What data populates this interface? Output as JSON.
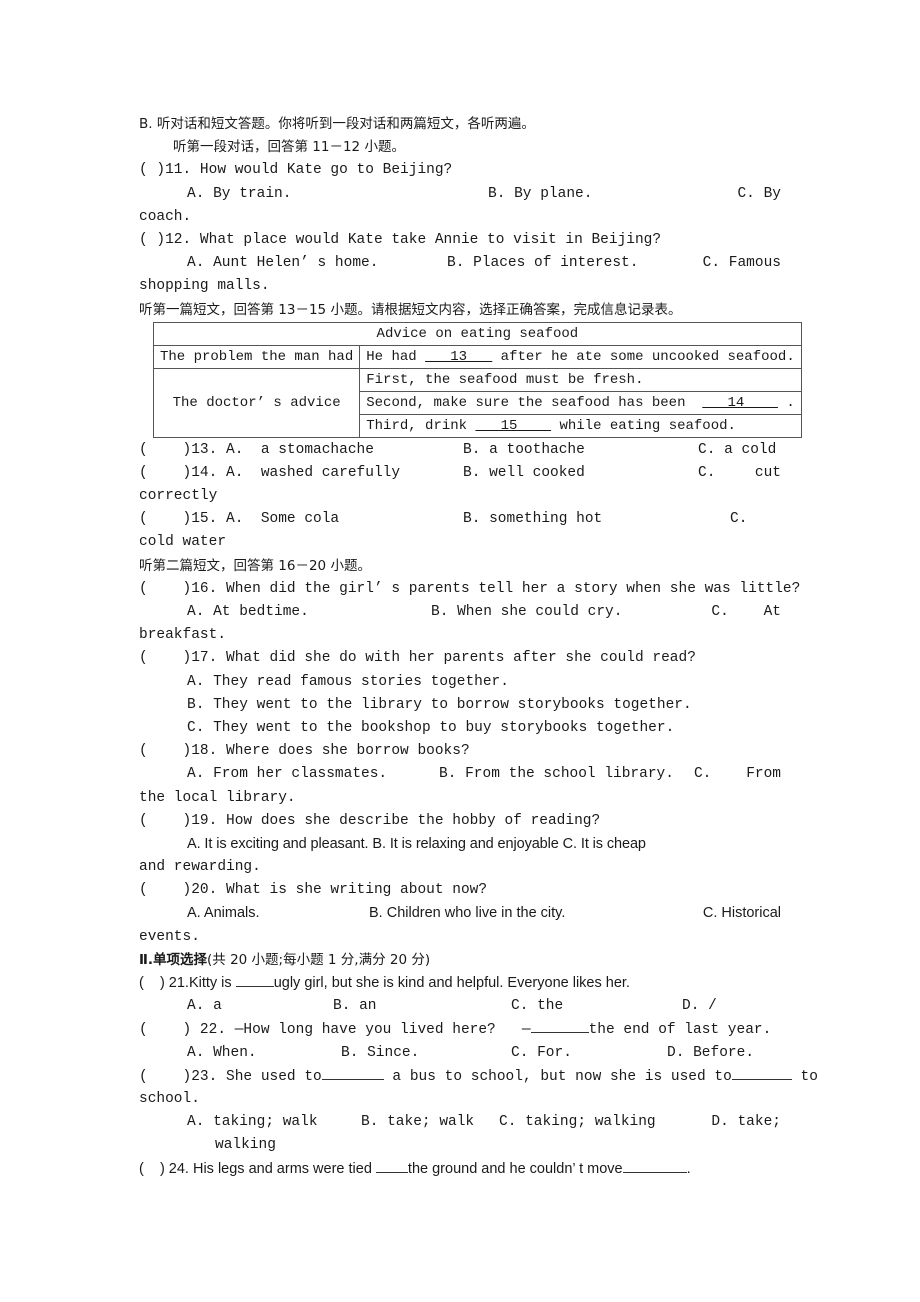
{
  "section_b": {
    "heading": "B.  听对话和短文答题。你将听到一段对话和两篇短文，各听两遍。",
    "dialogue_intro": "听第一段对话，回答第 11－12 小题。"
  },
  "q11": {
    "stem": "(    )11. How would Kate go to Beijing?",
    "a": "A. By train.",
    "b": "B. By plane.",
    "c": "C. By",
    "c_cont": "coach."
  },
  "q12": {
    "stem": "(    )12. What place would Kate take Annie to visit in Beijing?",
    "a": "A. Aunt Helen’ s home.",
    "b": "B.  Places  of  interest.",
    "c": "C.  Famous",
    "c_cont": "shopping malls."
  },
  "passage1_intro": "听第一篇短文，回答第 13－15 小题。请根据短文内容，选择正确答案，完成信息记录表。",
  "info_table": {
    "title": "Advice on eating seafood",
    "row1_label": "The problem the man had",
    "row1_pre": "He had ",
    "row1_blank": "   13   ",
    "row1_post": " after he ate some uncooked seafood.",
    "row2_label": "The doctor’ s advice",
    "advice1": "First, the seafood must be fresh.",
    "advice2_pre": "Second, make sure the seafood has been  ",
    "advice2_blank": "   14    ",
    "advice2_post": " .",
    "advice3_pre": "Third, drink ",
    "advice3_blank": "   15    ",
    "advice3_post": " while eating seafood."
  },
  "q13": {
    "stem": "(    )13. A.  a stomachache",
    "b": "B.  a toothache",
    "c": "C.  a cold"
  },
  "q14": {
    "stem": "(    )14. A.  washed carefully",
    "b": "B.  well cooked",
    "c": "C.",
    "c_word": "cut",
    "c_cont": "correctly"
  },
  "q15": {
    "stem": "(    )15. A.  Some cola",
    "b": "B.  something hot",
    "c": "C.",
    "c_cont": "cold water"
  },
  "passage2_intro": "听第二篇短文，回答第 16－20 小题。",
  "q16": {
    "stem": "(    )16. When did the girl’ s parents tell her a story when she was little?",
    "a": "A. At bedtime.",
    "b": "B. When she could cry.",
    "c": "C.    At",
    "c_cont": "breakfast."
  },
  "q17": {
    "stem": "(    )17. What did she do with her parents after she could read?",
    "a": "A. They read famous stories together.",
    "b": "B. They went to the library to borrow storybooks together.",
    "c": "C. They went to the bookshop to buy storybooks together."
  },
  "q18": {
    "stem": "(    )18. Where does she borrow books?",
    "a": "A. From her classmates.",
    "b": "B. From the school library.",
    "c": "C.    From",
    "c_cont": "the local library."
  },
  "q19": {
    "stem": "(    )19. How does she describe the hobby of reading?",
    "options": "A. It is exciting and pleasant. B. It is relaxing and enjoyable C. It is cheap",
    "c_cont": "and rewarding."
  },
  "q20": {
    "stem": "(    )20. What is she writing about now?",
    "a": "A. Animals.",
    "b": "B. Children who live in the city.",
    "c": "C. Historical",
    "c_cont": "events."
  },
  "section_ii": {
    "heading_bold": "Ⅱ.单项选择",
    "heading_rest": "(共 20 小题;每小题 1 分,满分 20 分)"
  },
  "q21": {
    "stem_pre": "(    ) 21.Kitty is ",
    "stem_post": "ugly girl, but she is kind and helpful. Everyone likes her.",
    "a": "A.  a",
    "b": "B.  an",
    "c": "C.  the",
    "d": "D.  /"
  },
  "q22": {
    "stem_pre": "(    ) 22. —How long have you lived here?   —",
    "stem_post": "the end of last year.",
    "a": "A.  When.",
    "b": "B.  Since.",
    "c": "C.  For.",
    "d": "D.  Before."
  },
  "q23": {
    "stem_pre": "(    )23. She used to",
    "stem_mid": " a bus to school, but now she is used to",
    "stem_post": " to",
    "stem_cont": "school.",
    "a": "A.  taking; walk",
    "b": "B.  take; walk",
    "c": "C.  taking; walking",
    "d": "D.  take;",
    "d_cont": "walking"
  },
  "q24": {
    "stem_pre": "(    ) 24. His legs and arms were tied ",
    "stem_mid": "the ground and he couldn’ t move",
    "stem_post": "."
  }
}
